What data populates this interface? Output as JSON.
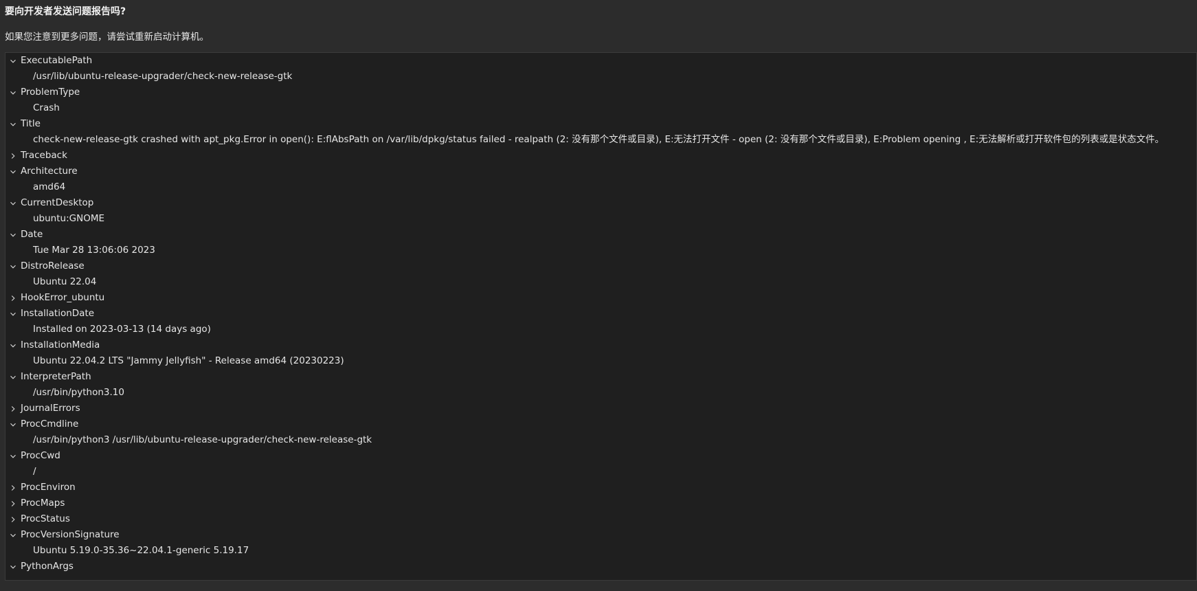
{
  "dialog": {
    "heading": "要向开发者发送问题报告吗?",
    "subheading": "如果您注意到更多问题，请尝试重新启动计算机。"
  },
  "icons": {
    "expanded": "chevron-down-icon",
    "collapsed": "chevron-right-icon"
  },
  "colors": {
    "background": "#2c2c2c",
    "tree_background": "#1f1f1f",
    "text": "#e6e6e6"
  },
  "report": {
    "items": [
      {
        "key": "ExecutablePath",
        "expanded": true,
        "value": "/usr/lib/ubuntu-release-upgrader/check-new-release-gtk"
      },
      {
        "key": "ProblemType",
        "expanded": true,
        "value": "Crash"
      },
      {
        "key": "Title",
        "expanded": true,
        "value": "check-new-release-gtk crashed with apt_pkg.Error in open(): E:flAbsPath on /var/lib/dpkg/status failed - realpath (2: 没有那个文件或目录), E:无法打开文件  - open (2: 没有那个文件或目录), E:Problem opening , E:无法解析或打开软件包的列表或是状态文件。"
      },
      {
        "key": "Traceback",
        "expanded": false,
        "value": ""
      },
      {
        "key": "Architecture",
        "expanded": true,
        "value": "amd64"
      },
      {
        "key": "CurrentDesktop",
        "expanded": true,
        "value": "ubuntu:GNOME"
      },
      {
        "key": "Date",
        "expanded": true,
        "value": "Tue Mar 28 13:06:06 2023"
      },
      {
        "key": "DistroRelease",
        "expanded": true,
        "value": "Ubuntu 22.04"
      },
      {
        "key": "HookError_ubuntu",
        "expanded": false,
        "value": ""
      },
      {
        "key": "InstallationDate",
        "expanded": true,
        "value": "Installed on 2023-03-13 (14 days ago)"
      },
      {
        "key": "InstallationMedia",
        "expanded": true,
        "value": "Ubuntu 22.04.2 LTS \"Jammy Jellyfish\" - Release amd64 (20230223)"
      },
      {
        "key": "InterpreterPath",
        "expanded": true,
        "value": "/usr/bin/python3.10"
      },
      {
        "key": "JournalErrors",
        "expanded": false,
        "value": ""
      },
      {
        "key": "ProcCmdline",
        "expanded": true,
        "value": "/usr/bin/python3 /usr/lib/ubuntu-release-upgrader/check-new-release-gtk"
      },
      {
        "key": "ProcCwd",
        "expanded": true,
        "value": "/"
      },
      {
        "key": "ProcEnviron",
        "expanded": false,
        "value": ""
      },
      {
        "key": "ProcMaps",
        "expanded": false,
        "value": ""
      },
      {
        "key": "ProcStatus",
        "expanded": false,
        "value": ""
      },
      {
        "key": "ProcVersionSignature",
        "expanded": true,
        "value": "Ubuntu 5.19.0-35.36~22.04.1-generic 5.19.17"
      },
      {
        "key": "PythonArgs",
        "expanded": true,
        "value": ""
      }
    ]
  }
}
